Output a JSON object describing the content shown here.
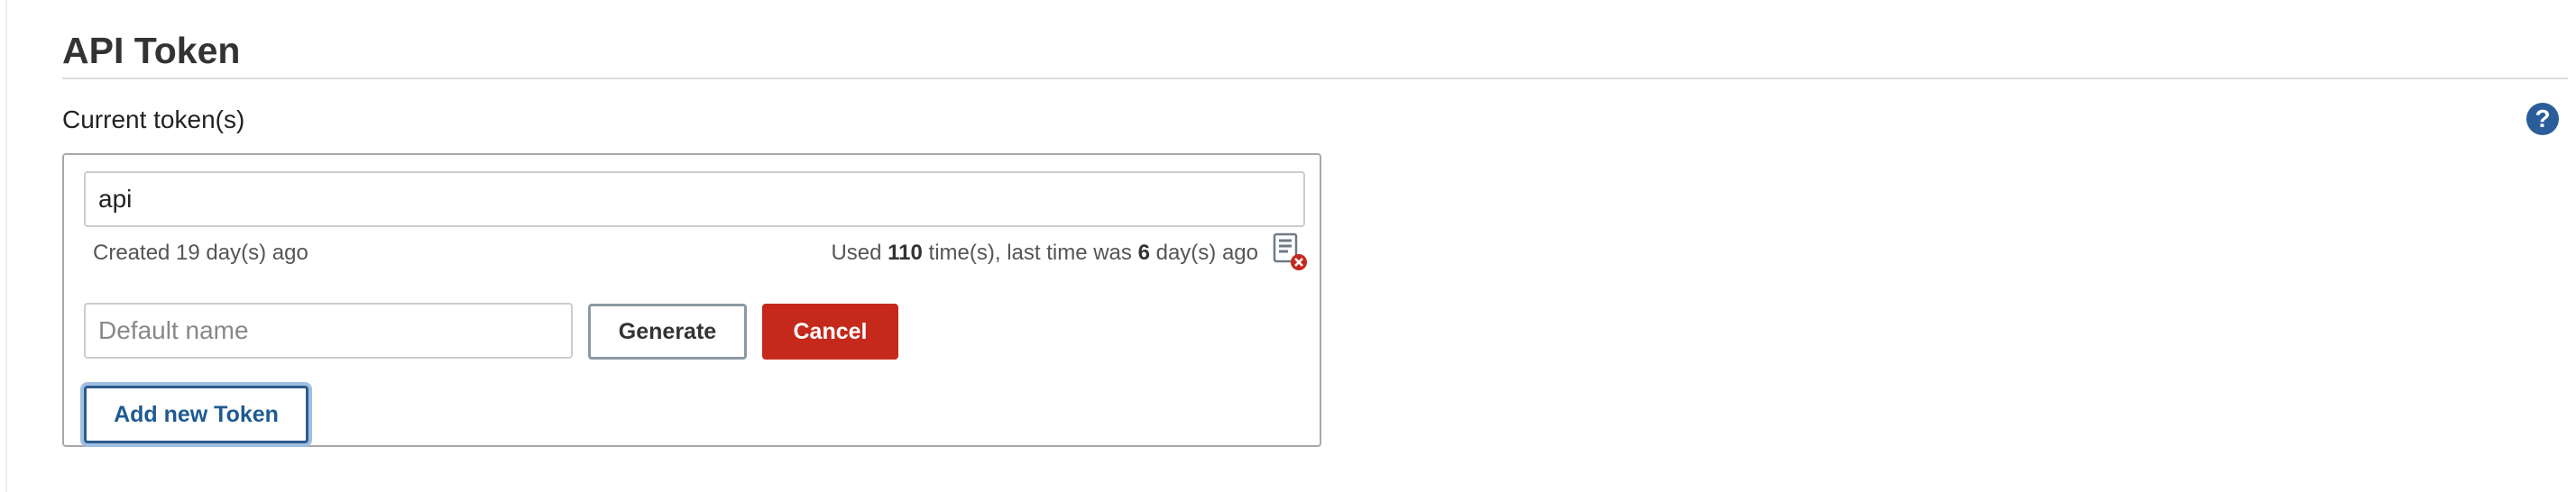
{
  "section": {
    "title": "API Token"
  },
  "current_tokens": {
    "label": "Current token(s)",
    "help_icon": "question-circle-icon",
    "tokens": [
      {
        "name": "api",
        "created": "Created 19 day(s) ago",
        "usage_prefix": "Used",
        "use_count": "110",
        "usage_middle": "time(s), last time was",
        "days_ago": "6",
        "usage_suffix": "day(s) ago",
        "revoke_icon": "revoke-token-icon"
      }
    ]
  },
  "new_token": {
    "placeholder": "Default name",
    "value": "",
    "generate_label": "Generate",
    "cancel_label": "Cancel"
  },
  "add_button_label": "Add new Token",
  "colors": {
    "cancel": "#c4291c",
    "help": "#2a5d9a",
    "add_button_text": "#1d5a92",
    "add_button_focus": "#9fbfe0"
  }
}
